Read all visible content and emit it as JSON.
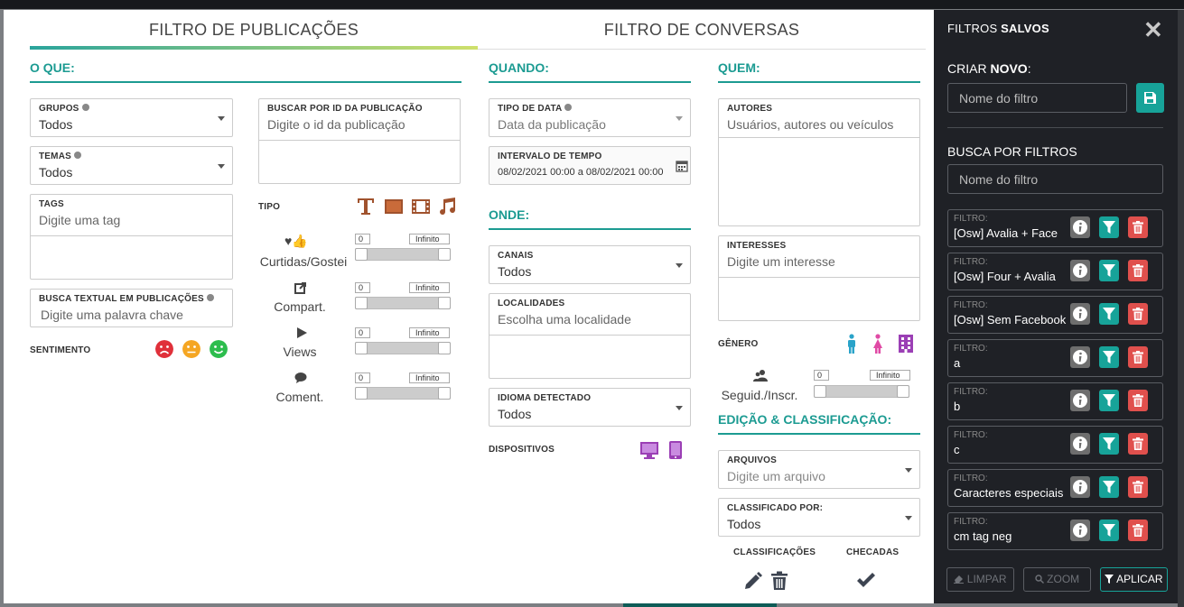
{
  "tabs": {
    "publicacoes": "FILTRO DE PUBLICAÇÕES",
    "conversas": "FILTRO DE CONVERSAS"
  },
  "sections": {
    "oque": "O QUE:",
    "quando": "QUANDO:",
    "onde": "ONDE:",
    "quem": "QUEM:",
    "edicao": "EDIÇÃO & CLASSIFICAÇÃO:"
  },
  "fields": {
    "grupos": {
      "label": "GRUPOS",
      "value": "Todos"
    },
    "temas": {
      "label": "TEMAS",
      "value": "Todos"
    },
    "tags": {
      "label": "TAGS",
      "placeholder": "Digite uma tag"
    },
    "busca_textual": {
      "label": "BUSCA TEXTUAL EM PUBLICAÇÕES",
      "placeholder": "Digite uma palavra chave"
    },
    "buscar_id": {
      "label": "BUSCAR POR ID DA PUBLICAÇÃO",
      "placeholder": "Digite o id da publicação"
    },
    "tipo_data": {
      "label": "TIPO DE DATA",
      "value": "Data da publicação"
    },
    "intervalo": {
      "label": "INTERVALO DE TEMPO",
      "value": "08/02/2021 00:00 a 08/02/2021 00:00"
    },
    "canais": {
      "label": "CANAIS",
      "value": "Todos"
    },
    "localidades": {
      "label": "LOCALIDADES",
      "placeholder": "Escolha uma localidade"
    },
    "idioma": {
      "label": "IDIOMA DETECTADO",
      "value": "Todos"
    },
    "autores": {
      "label": "AUTORES",
      "placeholder": "Usuários, autores ou veículos"
    },
    "interesses": {
      "label": "INTERESSES",
      "placeholder": "Digite um interesse"
    },
    "arquivos": {
      "label": "ARQUIVOS",
      "placeholder": "Digite um arquivo"
    },
    "classificado": {
      "label": "CLASSIFICADO POR:",
      "value": "Todos"
    }
  },
  "labels": {
    "sentimento": "SENTIMENTO",
    "tipo": "TIPO",
    "dispositivos": "DISPOSITIVOS",
    "genero": "GÊNERO",
    "classificacoes": "CLASSIFICAÇÕES",
    "checadas": "CHECADAS"
  },
  "sliders": [
    {
      "label": "Curtidas/Gostei",
      "min": "0",
      "max": "Infinito"
    },
    {
      "label": "Compart.",
      "min": "0",
      "max": "Infinito"
    },
    {
      "label": "Views",
      "min": "0",
      "max": "Infinito"
    },
    {
      "label": "Coment.",
      "min": "0",
      "max": "Infinito"
    }
  ],
  "seguidores": {
    "label": "Seguid./Inscr.",
    "min": "0",
    "max": "Infinito"
  },
  "colors": {
    "accent": "#1c9b92",
    "tipo": "#a0522d",
    "device": "#9b3fb5",
    "male": "#2aa3c9",
    "female": "#e04aa5",
    "sad": "#e0303a",
    "neutral": "#f5a623",
    "happy": "#2dbd4e"
  },
  "side": {
    "title_a": "FILTROS ",
    "title_b": "SALVOS",
    "create_a": "CRIAR ",
    "create_b": "NOVO",
    "create_colon": ":",
    "name_placeholder": "Nome do filtro",
    "search_head": "BUSCA POR FILTROS",
    "search_placeholder": "Nome do filtro",
    "filter_label": "FILTRO:",
    "filters": [
      "[Osw] Avalia + Face",
      "[Osw] Four + Avalia",
      "[Osw] Sem Facebook",
      "a",
      "b",
      "c",
      "Caracteres especiais",
      "cm tag neg"
    ],
    "btn_limpar": "LIMPAR",
    "btn_zoom": "ZOOM",
    "btn_aplicar": "APLICAR"
  }
}
